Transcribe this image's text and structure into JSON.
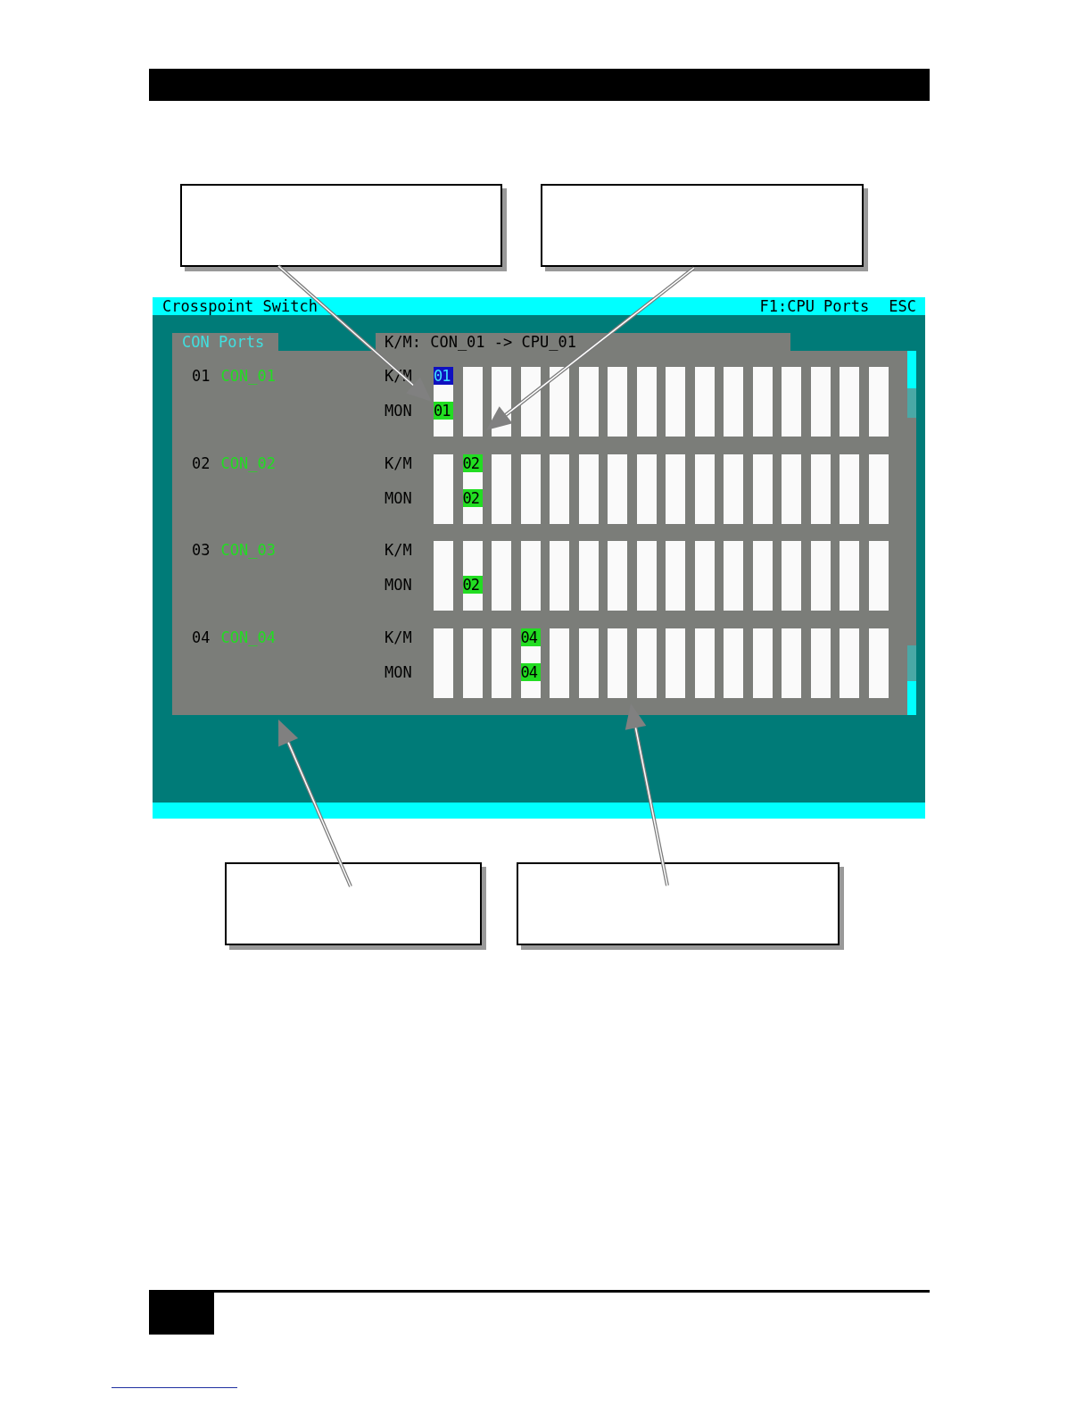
{
  "window": {
    "title": "Crosspoint Switch",
    "hotkeys": [
      {
        "label": "F1:CPU Ports"
      },
      {
        "label": "ESC"
      }
    ]
  },
  "tab": {
    "label": "CON Ports",
    "selected": true
  },
  "connection_status": "K/M: CON_01 -> CPU_01",
  "ports": [
    {
      "number": "01",
      "name": "CON_01",
      "km_label": "K/M",
      "mon_label": "MON",
      "slots": [
        {
          "km_connected": true,
          "km_text": "01",
          "km_selected": true,
          "mon_connected": true,
          "mon_text": "01",
          "mon_selected": false
        },
        {
          "km_connected": false,
          "mon_connected": false
        },
        {
          "km_connected": false,
          "mon_connected": false
        },
        {
          "km_connected": false,
          "mon_connected": false
        },
        {
          "km_connected": false,
          "mon_connected": false
        },
        {
          "km_connected": false,
          "mon_connected": false
        },
        {
          "km_connected": false,
          "mon_connected": false
        },
        {
          "km_connected": false,
          "mon_connected": false
        },
        {
          "km_connected": false,
          "mon_connected": false
        },
        {
          "km_connected": false,
          "mon_connected": false
        },
        {
          "km_connected": false,
          "mon_connected": false
        },
        {
          "km_connected": false,
          "mon_connected": false
        },
        {
          "km_connected": false,
          "mon_connected": false
        },
        {
          "km_connected": false,
          "mon_connected": false
        },
        {
          "km_connected": false,
          "mon_connected": false
        },
        {
          "km_connected": false,
          "mon_connected": false
        }
      ]
    },
    {
      "number": "02",
      "name": "CON_02",
      "km_label": "K/M",
      "mon_label": "MON",
      "slots": [
        {
          "km_connected": false,
          "mon_connected": false
        },
        {
          "km_connected": true,
          "km_text": "02",
          "km_selected": false,
          "mon_connected": true,
          "mon_text": "02",
          "mon_selected": false
        },
        {
          "km_connected": false,
          "mon_connected": false
        },
        {
          "km_connected": false,
          "mon_connected": false
        },
        {
          "km_connected": false,
          "mon_connected": false
        },
        {
          "km_connected": false,
          "mon_connected": false
        },
        {
          "km_connected": false,
          "mon_connected": false
        },
        {
          "km_connected": false,
          "mon_connected": false
        },
        {
          "km_connected": false,
          "mon_connected": false
        },
        {
          "km_connected": false,
          "mon_connected": false
        },
        {
          "km_connected": false,
          "mon_connected": false
        },
        {
          "km_connected": false,
          "mon_connected": false
        },
        {
          "km_connected": false,
          "mon_connected": false
        },
        {
          "km_connected": false,
          "mon_connected": false
        },
        {
          "km_connected": false,
          "mon_connected": false
        },
        {
          "km_connected": false,
          "mon_connected": false
        }
      ]
    },
    {
      "number": "03",
      "name": "CON_03",
      "km_label": "K/M",
      "mon_label": "MON",
      "slots": [
        {
          "km_connected": false,
          "mon_connected": false
        },
        {
          "km_connected": false,
          "mon_connected": true,
          "mon_text": "02",
          "mon_selected": false
        },
        {
          "km_connected": false,
          "mon_connected": false
        },
        {
          "km_connected": false,
          "mon_connected": false
        },
        {
          "km_connected": false,
          "mon_connected": false
        },
        {
          "km_connected": false,
          "mon_connected": false
        },
        {
          "km_connected": false,
          "mon_connected": false
        },
        {
          "km_connected": false,
          "mon_connected": false
        },
        {
          "km_connected": false,
          "mon_connected": false
        },
        {
          "km_connected": false,
          "mon_connected": false
        },
        {
          "km_connected": false,
          "mon_connected": false
        },
        {
          "km_connected": false,
          "mon_connected": false
        },
        {
          "km_connected": false,
          "mon_connected": false
        },
        {
          "km_connected": false,
          "mon_connected": false
        },
        {
          "km_connected": false,
          "mon_connected": false
        },
        {
          "km_connected": false,
          "mon_connected": false
        }
      ]
    },
    {
      "number": "04",
      "name": "CON_04",
      "km_label": "K/M",
      "mon_label": "MON",
      "slots": [
        {
          "km_connected": false,
          "mon_connected": false
        },
        {
          "km_connected": false,
          "mon_connected": false
        },
        {
          "km_connected": false,
          "mon_connected": false
        },
        {
          "km_connected": true,
          "km_text": "04",
          "km_selected": false,
          "mon_connected": true,
          "mon_text": "04",
          "mon_selected": false
        },
        {
          "km_connected": false,
          "mon_connected": false
        },
        {
          "km_connected": false,
          "mon_connected": false
        },
        {
          "km_connected": false,
          "mon_connected": false
        },
        {
          "km_connected": false,
          "mon_connected": false
        },
        {
          "km_connected": false,
          "mon_connected": false
        },
        {
          "km_connected": false,
          "mon_connected": false
        },
        {
          "km_connected": false,
          "mon_connected": false
        },
        {
          "km_connected": false,
          "mon_connected": false
        },
        {
          "km_connected": false,
          "mon_connected": false
        },
        {
          "km_connected": false,
          "mon_connected": false
        },
        {
          "km_connected": false,
          "mon_connected": false
        },
        {
          "km_connected": false,
          "mon_connected": false
        }
      ]
    }
  ]
}
